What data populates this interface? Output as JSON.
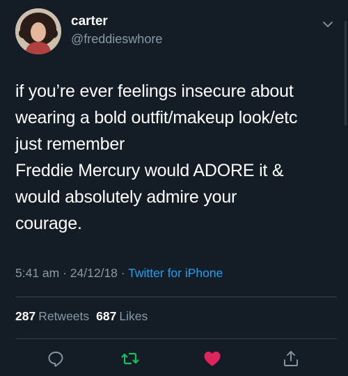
{
  "user": {
    "display_name": "carter",
    "handle": "@freddieswhore"
  },
  "tweet": {
    "text": "if you’re ever feelings insecure about\nwearing a bold outfit/makeup look/etc\njust remember\n Freddie Mercury would ADORE it &\nwould absolutely admire your\ncourage."
  },
  "meta": {
    "time": "5:41 am",
    "separator1": " · ",
    "date": "24/12/18",
    "separator2": " · ",
    "source": "Twitter for iPhone"
  },
  "stats": {
    "retweets_count": "287",
    "retweets_label": "Retweets",
    "likes_count": "687",
    "likes_label": "Likes"
  },
  "actions": {
    "reply_icon": "reply-icon",
    "retweet_icon": "retweet-icon",
    "like_icon": "heart-icon",
    "share_icon": "share-icon"
  },
  "colors": {
    "background": "#141d26",
    "secondary_text": "#8899a6",
    "link": "#1da1f2",
    "retweet": "#17bf63",
    "like": "#e0245e",
    "divider": "#38444d"
  }
}
